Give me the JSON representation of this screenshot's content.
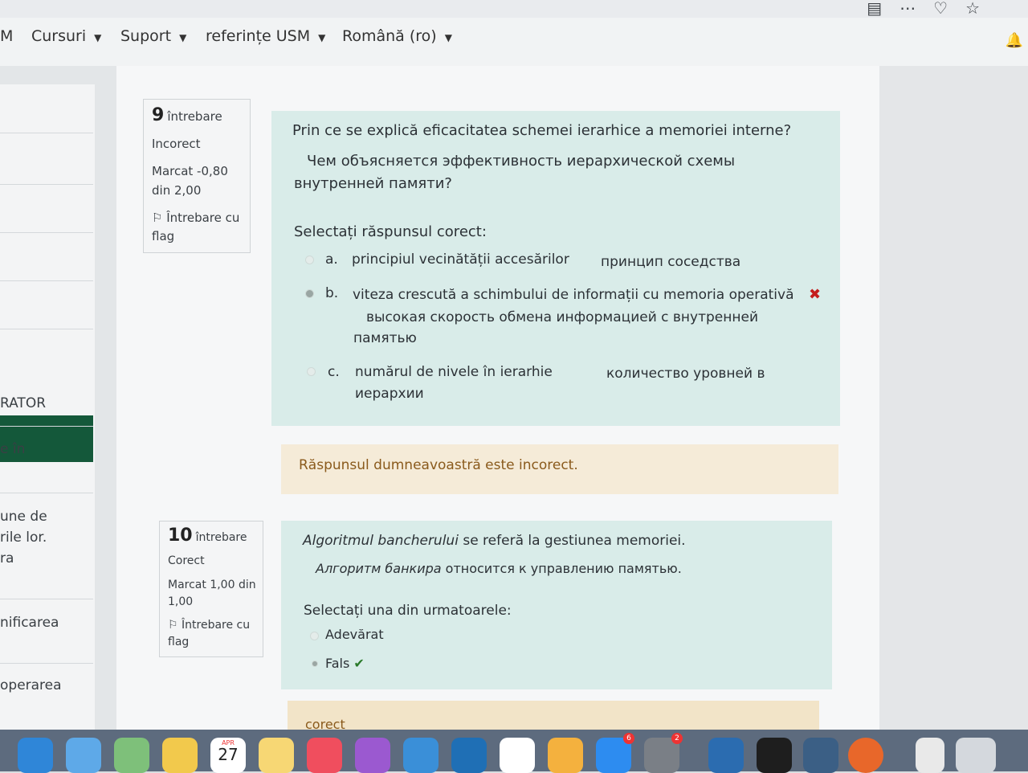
{
  "nav": {
    "items": [
      "Cursuri",
      "Suport",
      "referințe USM",
      "Română (ro)"
    ],
    "partial_left": "M"
  },
  "sidebar": {
    "fragments": [
      "RATOR",
      "e în",
      "une de",
      "rile lor.",
      "ra",
      "nificarea",
      "operarea"
    ]
  },
  "q9": {
    "number": "9",
    "word": "întrebare",
    "status": "Incorect",
    "mark_line1": "Marcat -0,80",
    "mark_line2": "din 2,00",
    "flag_line1": "Întrebare cu",
    "flag_line2": "flag",
    "text_ro": "Prin ce se explică eficacitatea schemei ierarhice a memoriei interne?",
    "text_ru_line1": "Чем объясняется эффективность иерархической схемы",
    "text_ru_line2": "внутренней памяти?",
    "prompt": "Selectați răspunsul corect:",
    "answers": [
      {
        "letter": "a.",
        "ro": "principiul vecinătății accesărilor",
        "ru": "принцип соседства"
      },
      {
        "letter": "b.",
        "ro": "viteza crescută a schimbului de informații cu memoria operativă",
        "ru": "высокая скорость обмена информацией с внутренней",
        "ru2": "памятью"
      },
      {
        "letter": "c.",
        "ro": "numărul de nivele în ierarhie",
        "ru": "количество уровней в",
        "ru2": "иерархии"
      }
    ],
    "feedback": "Răspunsul dumneavoastră este incorect."
  },
  "q10": {
    "number": "10",
    "word": "întrebare",
    "status": "Corect",
    "mark_line1": "Marcat 1,00 din",
    "mark_line2": "1,00",
    "flag_line1": "Întrebare cu",
    "flag_line2": "flag",
    "text_ro_italic": "Algoritmul bancherului",
    "text_ro_rest": " se referă la gestiunea memoriei.",
    "text_ru_italic": "Алгоритм банкира",
    "text_ru_rest": " относится к управлению памятью.",
    "prompt": "Selectați una din urmatoarele:",
    "option_true": "Adevărat",
    "option_false": "Fals",
    "next_feedback": "corect"
  },
  "dock": {
    "calendar_month": "APR",
    "calendar_day": "27",
    "badge_appstore": "6",
    "badge_settings": "2"
  },
  "colors": {
    "question_bg": "#d9ece9",
    "feedback_bg": "#f5ebd8",
    "sidebar_active": "#14583a"
  }
}
